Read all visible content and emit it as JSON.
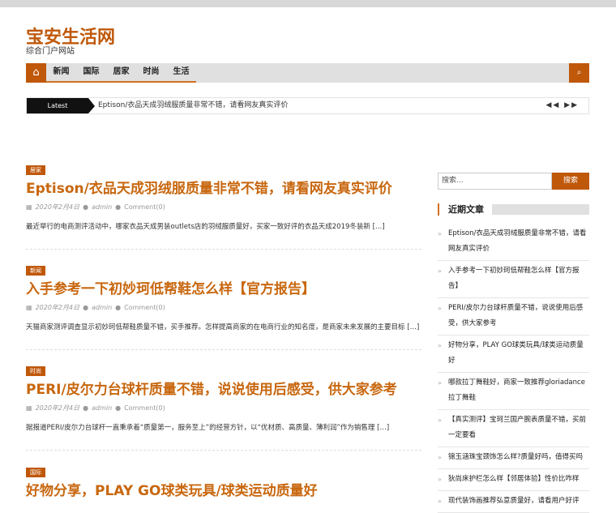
{
  "site": {
    "title": "宝安生活网",
    "description": "综合门户网站"
  },
  "nav": {
    "home_icon": "home-icon",
    "items": [
      "新闻",
      "国际",
      "居家",
      "时尚",
      "生活"
    ],
    "search_icon": "search-icon"
  },
  "ticker": {
    "label": "Latest",
    "text": "Eptison/衣品天成羽绒服质量非常不错，请看网友真实评价",
    "controls": "◀◀ ▶▶"
  },
  "posts": [
    {
      "tag": "居家",
      "title": "Eptison/衣品天成羽绒服质量非常不错，请看网友真实评价",
      "date": "2020年2月4日",
      "author": "admin",
      "comments": "Comment(0)",
      "excerpt": "最近举行的电商测评活动中，哪家衣品天成男装outlets店的羽绒服质量好，买家一致好评的衣品天成2019冬装新 […]"
    },
    {
      "tag": "新闻",
      "title": "入手参考一下初妙珂低帮鞋怎么样【官方报告】",
      "date": "2020年2月4日",
      "author": "admin",
      "comments": "Comment(0)",
      "excerpt": "天猫商家测评调查显示初妙珂低帮鞋质量不错，买手推荐。怎样提高商家的在电商行业的知名度，是商家未来发展的主要目标 […]"
    },
    {
      "tag": "时尚",
      "title": "PERI/皮尔力台球杆质量不错，说说使用后感受，供大家参考",
      "date": "2020年2月4日",
      "author": "admin",
      "comments": "Comment(0)",
      "excerpt": "据报道PERI/皮尔力台球杆一直秉承着“质量第一，服务至上”的经营方针，以“优材质、高质量、薄利润”作为销售理 […]"
    },
    {
      "tag": "国际",
      "title": "好物分享，PLAY GO球类玩具/球类运动质量好"
    }
  ],
  "sidebar": {
    "search_placeholder": "搜索...",
    "search_button": "搜索",
    "recent_title": "近期文章",
    "recent": [
      "Eptison/衣品天成羽绒服质量非常不错，请看网友真实评价",
      "入手参考一下初妙珂低帮鞋怎么样【官方报告】",
      "PERI/皮尔力台球杆质量不错，说说使用后感受，供大家参考",
      "好物分享，PLAY GO球类玩具/球类运动质量好",
      "哪款拉丁舞鞋好，商家一致推荐gloriadance拉丁舞鞋",
      "【真实测评】宝珂兰国产腕表质量不错，买前一定要看",
      "锦玉涵珠宝颈饰怎么样?质量好吗，值得买吗",
      "狄尚床护栏怎么样【邻居体验】性价比咋样",
      "现代装饰画推荐弘意质量好，请看用户好评"
    ]
  },
  "colors": {
    "accent": "#c0580a",
    "title": "#c8670f"
  }
}
